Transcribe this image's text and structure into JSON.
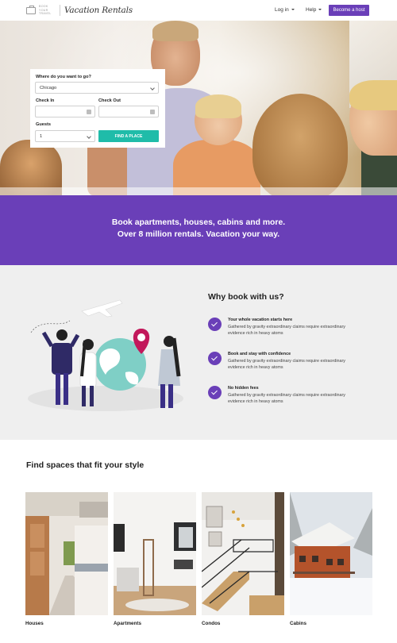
{
  "header": {
    "logo_small": "BOOK YOUR TRAVEL",
    "logo_script": "Vacation Rentals",
    "nav_login": "Log in",
    "nav_help": "Help",
    "host_button": "Become a host",
    "accent": "#6a3fb8"
  },
  "search": {
    "where_label": "Where do you want to go?",
    "where_value": "Chicago",
    "checkin_label": "Check In",
    "checkout_label": "Check Out",
    "guests_label": "Guests",
    "guests_value": "1",
    "find_button": "FIND A PLACE",
    "button_color": "#1fbca9"
  },
  "band": {
    "line1": "Book apartments, houses, cabins and more.",
    "line2": "Over 8 million rentals. Vacation your way."
  },
  "why": {
    "title": "Why book with us?",
    "items": [
      {
        "heading": "Your whole vacation starts here",
        "desc": "Gathered by gravity extraordinary claims require extraordinary evidence rich in heavy atoms"
      },
      {
        "heading": "Book and stay with confidence",
        "desc": "Gathered by gravity extraordinary claims require extraordinary evidence rich in heavy atoms"
      },
      {
        "heading": "No hidden fees",
        "desc": "Gathered by gravity extraordinary claims require extraordinary evidence rich in heavy atoms"
      }
    ]
  },
  "spaces": {
    "title": "Find spaces that fit your style",
    "cards": [
      {
        "label": "Houses"
      },
      {
        "label": "Apartments"
      },
      {
        "label": "Condos"
      },
      {
        "label": "Cabins"
      }
    ]
  }
}
